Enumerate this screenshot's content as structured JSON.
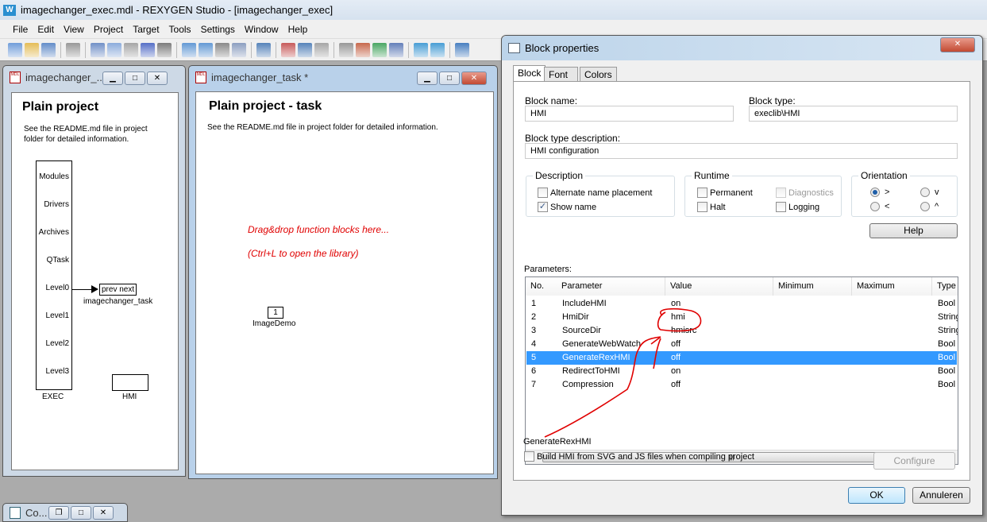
{
  "app": {
    "title": "imagechanger_exec.mdl - REXYGEN Studio - [imagechanger_exec]",
    "logo": "REXYGEN"
  },
  "menu": [
    "File",
    "Edit",
    "View",
    "Project",
    "Target",
    "Tools",
    "Settings",
    "Window",
    "Help"
  ],
  "toolbar": [
    "new-icon",
    "open-icon",
    "save-icon",
    "print-icon",
    "cut-icon",
    "copy-icon",
    "paste-icon",
    "undo-icon",
    "redo-icon",
    "zoom-in-icon",
    "zoom-out-icon",
    "zoom-fit-icon",
    "zoom-all-icon",
    "library-icon",
    "compile-icon",
    "download-icon",
    "inspect-icon",
    "connect-icon",
    "disconnect-icon",
    "refresh-icon",
    "list-icon",
    "watch-icon",
    "hmi-icon",
    "info-icon"
  ],
  "exec_window": {
    "title": "imagechanger_...",
    "heading": "Plain project",
    "note": "See the README.md file in project folder for detailed information.",
    "exec_ports": [
      "Modules",
      "Drivers",
      "Archives",
      "QTask",
      "Level0",
      "Level1",
      "Level2",
      "Level3"
    ],
    "exec_label": "EXEC",
    "task_ports": "prev  next",
    "task_label": "imagechanger_task",
    "hmi_label": "HMI"
  },
  "task_window": {
    "title": "imagechanger_task *",
    "heading": "Plain project - task",
    "note": "See the README.md file in project folder for detailed information.",
    "hint1": "Drag&drop function blocks here...",
    "hint2": "(Ctrl+L to open the library)",
    "block_value": "1",
    "block_label": "ImageDemo"
  },
  "minimized": {
    "title": "Co..."
  },
  "dialog": {
    "title": "Block properties",
    "tabs": [
      "Block",
      "Font",
      "Colors"
    ],
    "block_name_label": "Block name:",
    "block_name": "HMI",
    "block_type_label": "Block type:",
    "block_type": "execlib\\HMI",
    "block_desc_label": "Block type description:",
    "block_desc": "HMI configuration",
    "description": {
      "title": "Description",
      "alt_name": "Alternate name placement",
      "alt_name_checked": false,
      "show_name": "Show name",
      "show_name_checked": true
    },
    "runtime": {
      "title": "Runtime",
      "permanent": "Permanent",
      "halt": "Halt",
      "diagnostics": "Diagnostics",
      "logging": "Logging"
    },
    "orientation": {
      "title": "Orientation",
      "right": ">",
      "down": "v",
      "left": "<",
      "up": "^",
      "selected": ">"
    },
    "help": "Help",
    "params_label": "Parameters:",
    "columns": [
      "No.",
      "Parameter",
      "Value",
      "Minimum",
      "Maximum",
      "Type"
    ],
    "rows": [
      {
        "no": "1",
        "name": "IncludeHMI",
        "value": "on",
        "type": "Bool"
      },
      {
        "no": "2",
        "name": "HmiDir",
        "value": "hmi",
        "type": "String"
      },
      {
        "no": "3",
        "name": "SourceDir",
        "value": "hmisrc",
        "type": "String"
      },
      {
        "no": "4",
        "name": "GenerateWebWatch",
        "value": "off",
        "type": "Bool"
      },
      {
        "no": "5",
        "name": "GenerateRexHMI",
        "value": "off",
        "type": "Bool"
      },
      {
        "no": "6",
        "name": "RedirectToHMI",
        "value": "on",
        "type": "Bool"
      },
      {
        "no": "7",
        "name": "Compression",
        "value": "off",
        "type": "Bool"
      }
    ],
    "selected_row": "5",
    "param_name": "GenerateRexHMI",
    "param_desc": "Build HMI from SVG and JS files when compiling project",
    "configure": "Configure",
    "ok": "OK",
    "cancel": "Annuleren"
  },
  "colors": {
    "selection": "#3399ff",
    "annotation": "#e00000"
  }
}
